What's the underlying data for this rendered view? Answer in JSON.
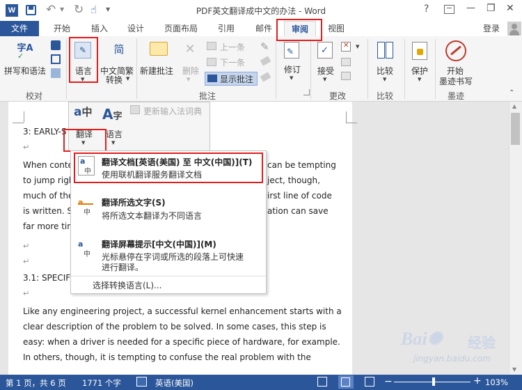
{
  "window": {
    "title": "PDF英文翻译成中文的办法 - Word",
    "help": "?",
    "minimize": "—",
    "restore": "❐",
    "close": "✕"
  },
  "tabs": [
    "文件",
    "开始",
    "插入",
    "设计",
    "页面布局",
    "引用",
    "邮件",
    "审阅",
    "视图"
  ],
  "login": "登录",
  "ribbon": {
    "spelling": "拼写和语法",
    "language": "语言",
    "cn_convert_line1": "中文简繁",
    "cn_convert_line2": "转换",
    "new_comment": "新建批注",
    "delete": "删除",
    "prev": "上一条",
    "next": "下一条",
    "show_comments": "显示批注",
    "track": "修订",
    "accept": "接受",
    "compare": "比较",
    "protect": "保护",
    "ink_line1": "开始",
    "ink_line2": "墨迹书写",
    "groups": {
      "proofing": "校对",
      "comments": "批注",
      "changes": "更改",
      "compare": "比较",
      "ink": "墨迹"
    }
  },
  "lang_popup": {
    "translate": "翻译",
    "language": "语言",
    "update_ime": "更新输入法词典"
  },
  "menu": {
    "item1_title": "翻译文档[英语(美国) 至 中文(中国)](T)",
    "item1_desc": "使用联机翻译服务翻译文档",
    "item2_title": "翻译所选文字(S)",
    "item2_desc": "将所选文本翻译为不同语言",
    "item3_title": "翻译屏幕提示[中文(中国)](M)",
    "item3_desc_line1": "光标悬停在字词或所选的段落上可快速",
    "item3_desc_line2": "进行翻译。",
    "choose_lang": "选择转换语言(L)..."
  },
  "doc": {
    "heading1": "3: EARLY-S",
    "p1_l1_left": "When conte",
    "p1_l1_right": "can be tempting",
    "p1_l2_left": "to jump righ",
    "p1_l2_right": "ject, though,",
    "p1_l3_left": "much of the",
    "p1_l3_right": "irst line of code",
    "p1_l4_left": "is written.  S",
    "p1_l4_right": "ation  can save",
    "p1_l5_left": "far more tin",
    "heading2": "3.1: SPECIFY",
    "p2_l1": "Like any engineering  project, a successful  kernel enhancement  starts with a",
    "p2_l2": "clear description  of the problem to be solved.  In some cases, this step is",
    "p2_l3": "easy: when a driver is needed for a specific piece of hardware, for example.",
    "p2_l4": "In others, though, it is tempting to confuse the real problem with the",
    "para_mark": "↵"
  },
  "status": {
    "page": "第 1 页，共 6 页",
    "words": "1771 个字",
    "lang": "英语(美国)",
    "zoom": "103%",
    "zoom_minus": "−",
    "zoom_plus": "+"
  },
  "watermark": {
    "brand": "Bai",
    "brand2": "经验",
    "url": "jingyan.baidu.com"
  },
  "colors": {
    "word_blue": "#2b579a",
    "highlight_red": "#e41c1c"
  }
}
